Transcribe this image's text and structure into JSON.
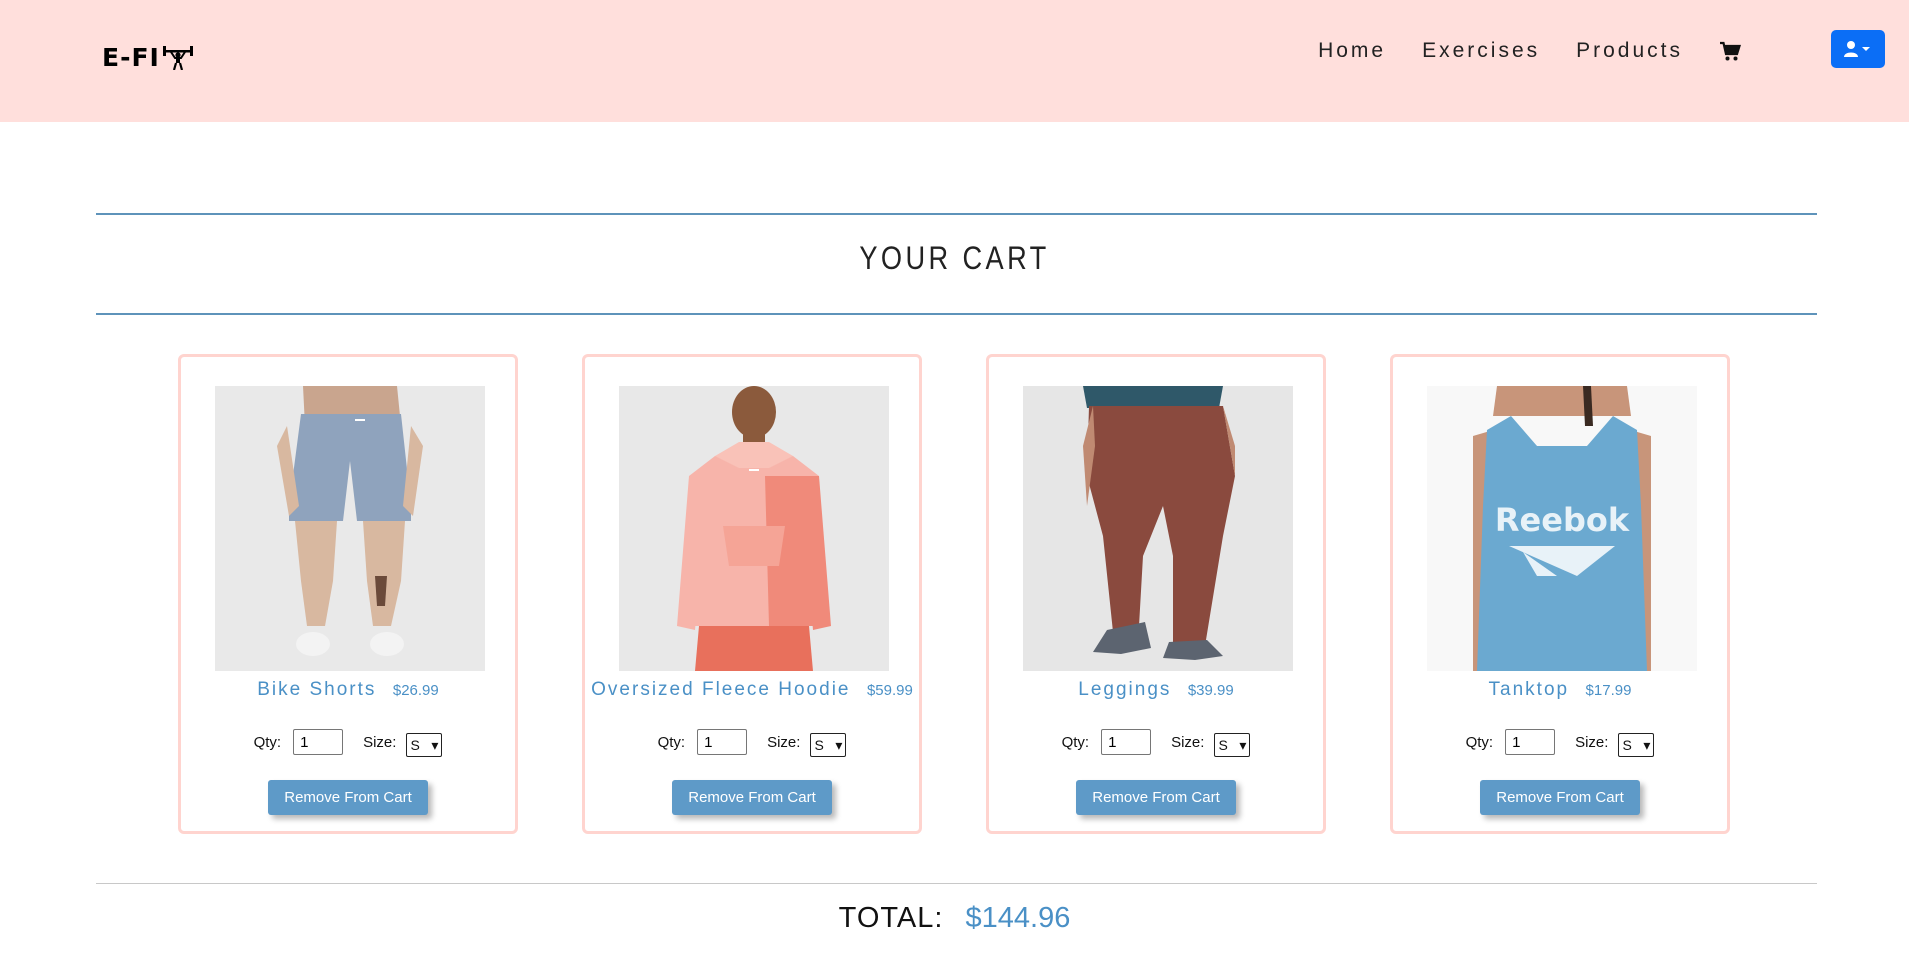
{
  "brand": {
    "logo_text": "E-FI",
    "logo_icon": "weightlifter-icon"
  },
  "nav": {
    "home": "Home",
    "exercises": "Exercises",
    "products": "Products",
    "cart_icon": "cart-icon",
    "user_icon": "user-dropdown-icon"
  },
  "page": {
    "title": "YOUR CART"
  },
  "cart": {
    "qty_label": "Qty:",
    "size_label": "Size:",
    "remove_label": "Remove From Cart",
    "items": [
      {
        "name": "Bike Shorts",
        "price": "$26.99",
        "qty": "1",
        "size": "S"
      },
      {
        "name": "Oversized Fleece Hoodie",
        "price": "$59.99",
        "qty": "1",
        "size": "S"
      },
      {
        "name": "Leggings",
        "price": "$39.99",
        "qty": "1",
        "size": "S"
      },
      {
        "name": "Tanktop",
        "price": "$17.99",
        "qty": "1",
        "size": "S"
      }
    ]
  },
  "total": {
    "label": "TOTAL:",
    "value": "$144.96"
  },
  "colors": {
    "header_bg": "#ffdfdc",
    "accent": "#4a90c6",
    "button": "#5e9ac8",
    "card_border": "#ffd4cf",
    "user_button": "#0b6ef6"
  }
}
